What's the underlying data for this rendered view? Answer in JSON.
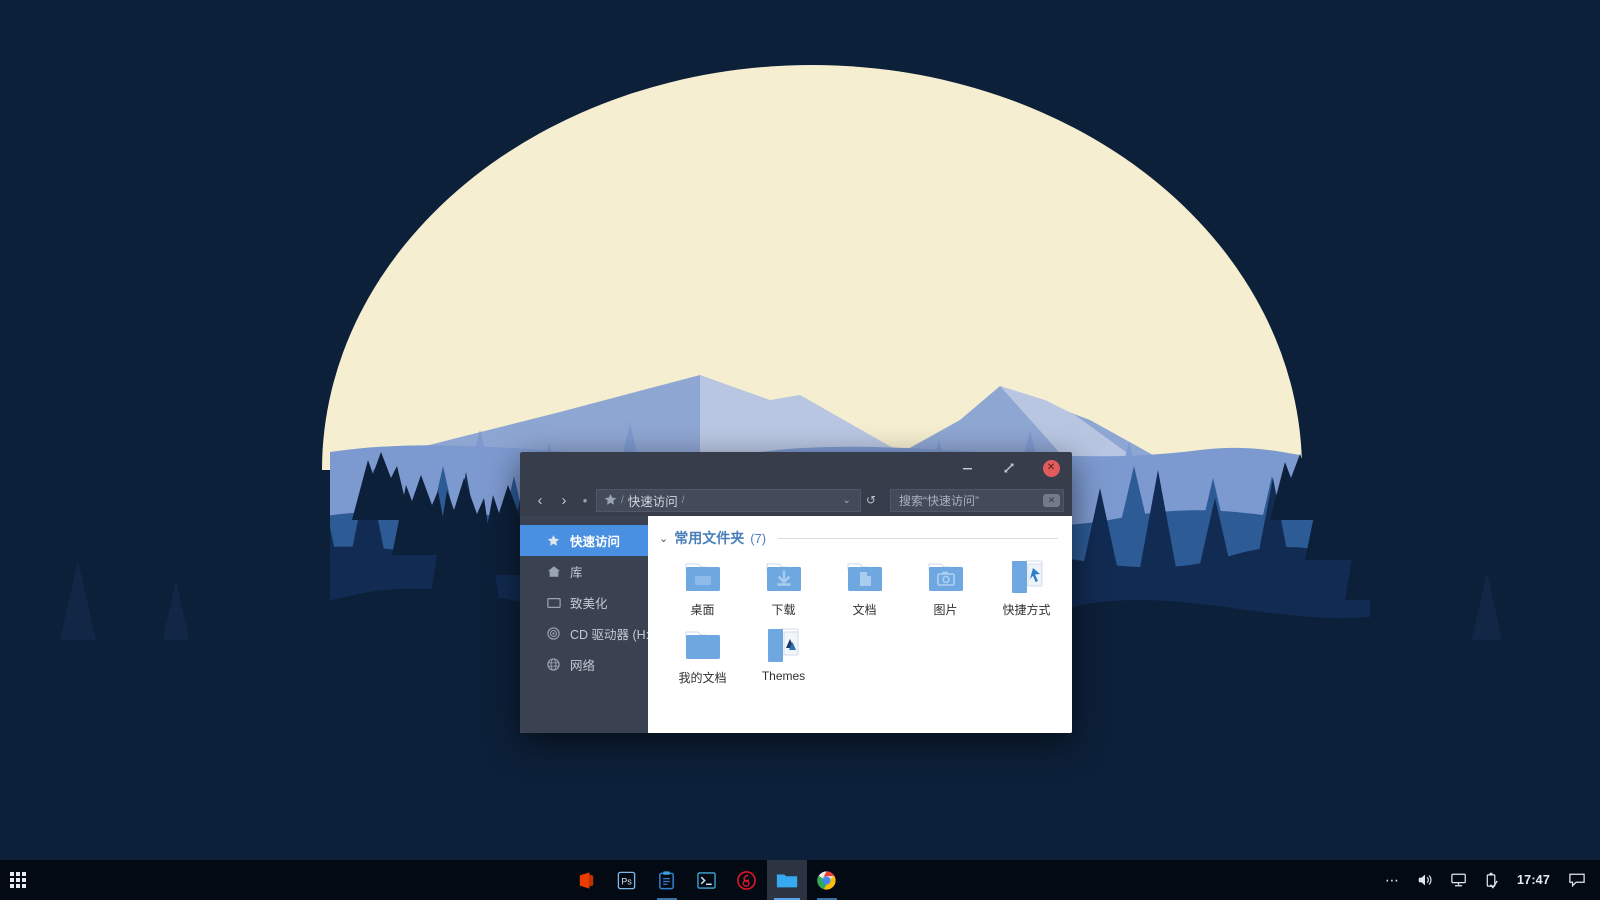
{
  "desktop": {
    "wallpaper": {
      "sky_color": "#0d2039",
      "moon_color": "#f5eed0",
      "mountain_light": "#b9c6e2",
      "mountain_mid": "#8ea6d2",
      "forest_far": "#7d9ad0",
      "forest_mid": "#2c5b96",
      "forest_near": "#112b52",
      "forest_dark": "#0d2039"
    }
  },
  "window": {
    "title": "快速访问",
    "controls": {
      "minimize_label": "–",
      "maximize_label": "maximize",
      "close_label": "✕"
    },
    "nav": {
      "back_label": "‹",
      "forward_label": "›",
      "up_label": "•",
      "breadcrumb": {
        "star_icon": "star-icon",
        "separator": "/",
        "path_label": "快速访问",
        "trailing_separator": "/",
        "chevron": "⌄"
      },
      "refresh_label": "↺"
    },
    "search": {
      "placeholder": "搜索“快速访问”",
      "value": "搜索“快速访问”",
      "clear_label": "✕"
    },
    "sidebar": {
      "items": [
        {
          "label": "快速访问",
          "icon": "star-icon",
          "active": true
        },
        {
          "label": "库",
          "icon": "library-icon",
          "active": false
        },
        {
          "label": "致美化",
          "icon": "monitor-icon",
          "active": false
        },
        {
          "label": "CD 驱动器 (H:)",
          "icon": "disc-icon",
          "active": false
        },
        {
          "label": "网络",
          "icon": "globe-icon",
          "active": false
        }
      ]
    },
    "content": {
      "group": {
        "chevron": "⌄",
        "title": "常用文件夹",
        "count": "(7)"
      },
      "items": [
        {
          "label": "桌面",
          "icon": "folder-desktop-icon"
        },
        {
          "label": "下载",
          "icon": "folder-download-icon"
        },
        {
          "label": "文档",
          "icon": "folder-document-icon"
        },
        {
          "label": "图片",
          "icon": "folder-pictures-icon"
        },
        {
          "label": "快捷方式",
          "icon": "folder-open-shortcut-icon"
        },
        {
          "label": "我的文档",
          "icon": "folder-plain-icon"
        },
        {
          "label": "Themes",
          "icon": "folder-open-themes-icon"
        }
      ]
    }
  },
  "taskbar": {
    "start": {
      "name": "app-launcher",
      "label": "apps-grid-icon"
    },
    "apps": [
      {
        "name": "office",
        "label": "Office",
        "color": "#eb3c00",
        "state": "idle"
      },
      {
        "name": "photoshop",
        "label": "Ps",
        "color": "#7fb6e8",
        "state": "idle"
      },
      {
        "name": "notes",
        "label": "Notes",
        "color": "#2f7fd0",
        "state": "running"
      },
      {
        "name": "terminal",
        "label": "Terminal",
        "color": "#3fa9d8",
        "state": "idle"
      },
      {
        "name": "netease-music",
        "label": "NetEase Music",
        "color": "#d8182a",
        "state": "idle"
      },
      {
        "name": "file-explorer",
        "label": "File Explorer",
        "color": "#36a9f0",
        "state": "active"
      },
      {
        "name": "chrome",
        "label": "Chrome",
        "color": "#4285f4",
        "state": "running"
      }
    ],
    "tray": {
      "overflow_label": "⋯",
      "volume_label": "volume-icon",
      "network_label": "network-icon",
      "usb_label": "usb-eject-icon",
      "clock": "17:47",
      "notifications_label": "notification-icon"
    }
  }
}
